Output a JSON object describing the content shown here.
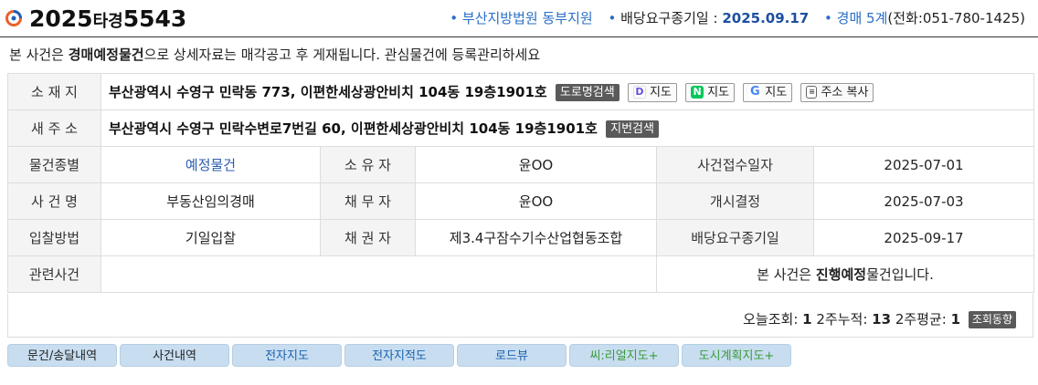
{
  "header": {
    "case_year": "2025",
    "case_type": "타경",
    "case_num": "5543",
    "court": "부산지방법원 동부지원",
    "deadline_label": "배당요구종기일 :",
    "deadline_date": "2025.09.17",
    "dept": "경매 5계",
    "phone": "(전화:051-780-1425)"
  },
  "notice": {
    "prefix": "본 사건은 ",
    "bold": "경매예정물건",
    "suffix": "으로 상세자료는 매각공고 후 게재됩니다. 관심물건에 등록관리하세요"
  },
  "address_row": {
    "label": "소 재 지",
    "value": "부산광역시 수영구 민락동 773, 이편한세상광안비치 104동 19층1901호",
    "road_search": "도로명검색",
    "daum_map": "지도",
    "naver_map": "지도",
    "google_map": "지도",
    "copy": "주소 복사"
  },
  "new_address_row": {
    "label": "새 주 소",
    "value": "부산광역시 수영구 민락수변로7번길 60, 이편한세상광안비치 104동 19층1901호",
    "lot_search": "지번검색"
  },
  "rows": [
    {
      "l1": "물건종별",
      "v1": "예정물건",
      "l2": "소 유 자",
      "v2": "윤OO",
      "l3": "사건접수일자",
      "v3": "2025-07-01"
    },
    {
      "l1": "사 건 명",
      "v1": "부동산임의경매",
      "l2": "채 무 자",
      "v2": "윤OO",
      "l3": "개시결정",
      "v3": "2025-07-03"
    },
    {
      "l1": "입찰방법",
      "v1": "기일입찰",
      "l2": "채 권 자",
      "v2": "제3.4구잠수기수산업협동조합",
      "l3": "배당요구종기일",
      "v3": "2025-09-17"
    }
  ],
  "related": {
    "label": "관련사건",
    "status_prefix": "본 사건은 ",
    "status_bold": "진행예정",
    "status_suffix": "물건입니다."
  },
  "stats": {
    "today_label": "오늘조회:",
    "today": "1",
    "two_week_label": "2주누적:",
    "two_week": "13",
    "avg_label": "2주평균:",
    "avg": "1",
    "trend_btn": "조회동향"
  },
  "tabs": [
    "문건/송달내역",
    "사건내역",
    "전자지도",
    "전자지적도",
    "로드뷰",
    "씨:리얼지도+",
    "도시계획지도+"
  ],
  "colors": {
    "accent": "#2a6ec6",
    "tab_bg": "#c8def0",
    "green": "#3b9a3b"
  }
}
